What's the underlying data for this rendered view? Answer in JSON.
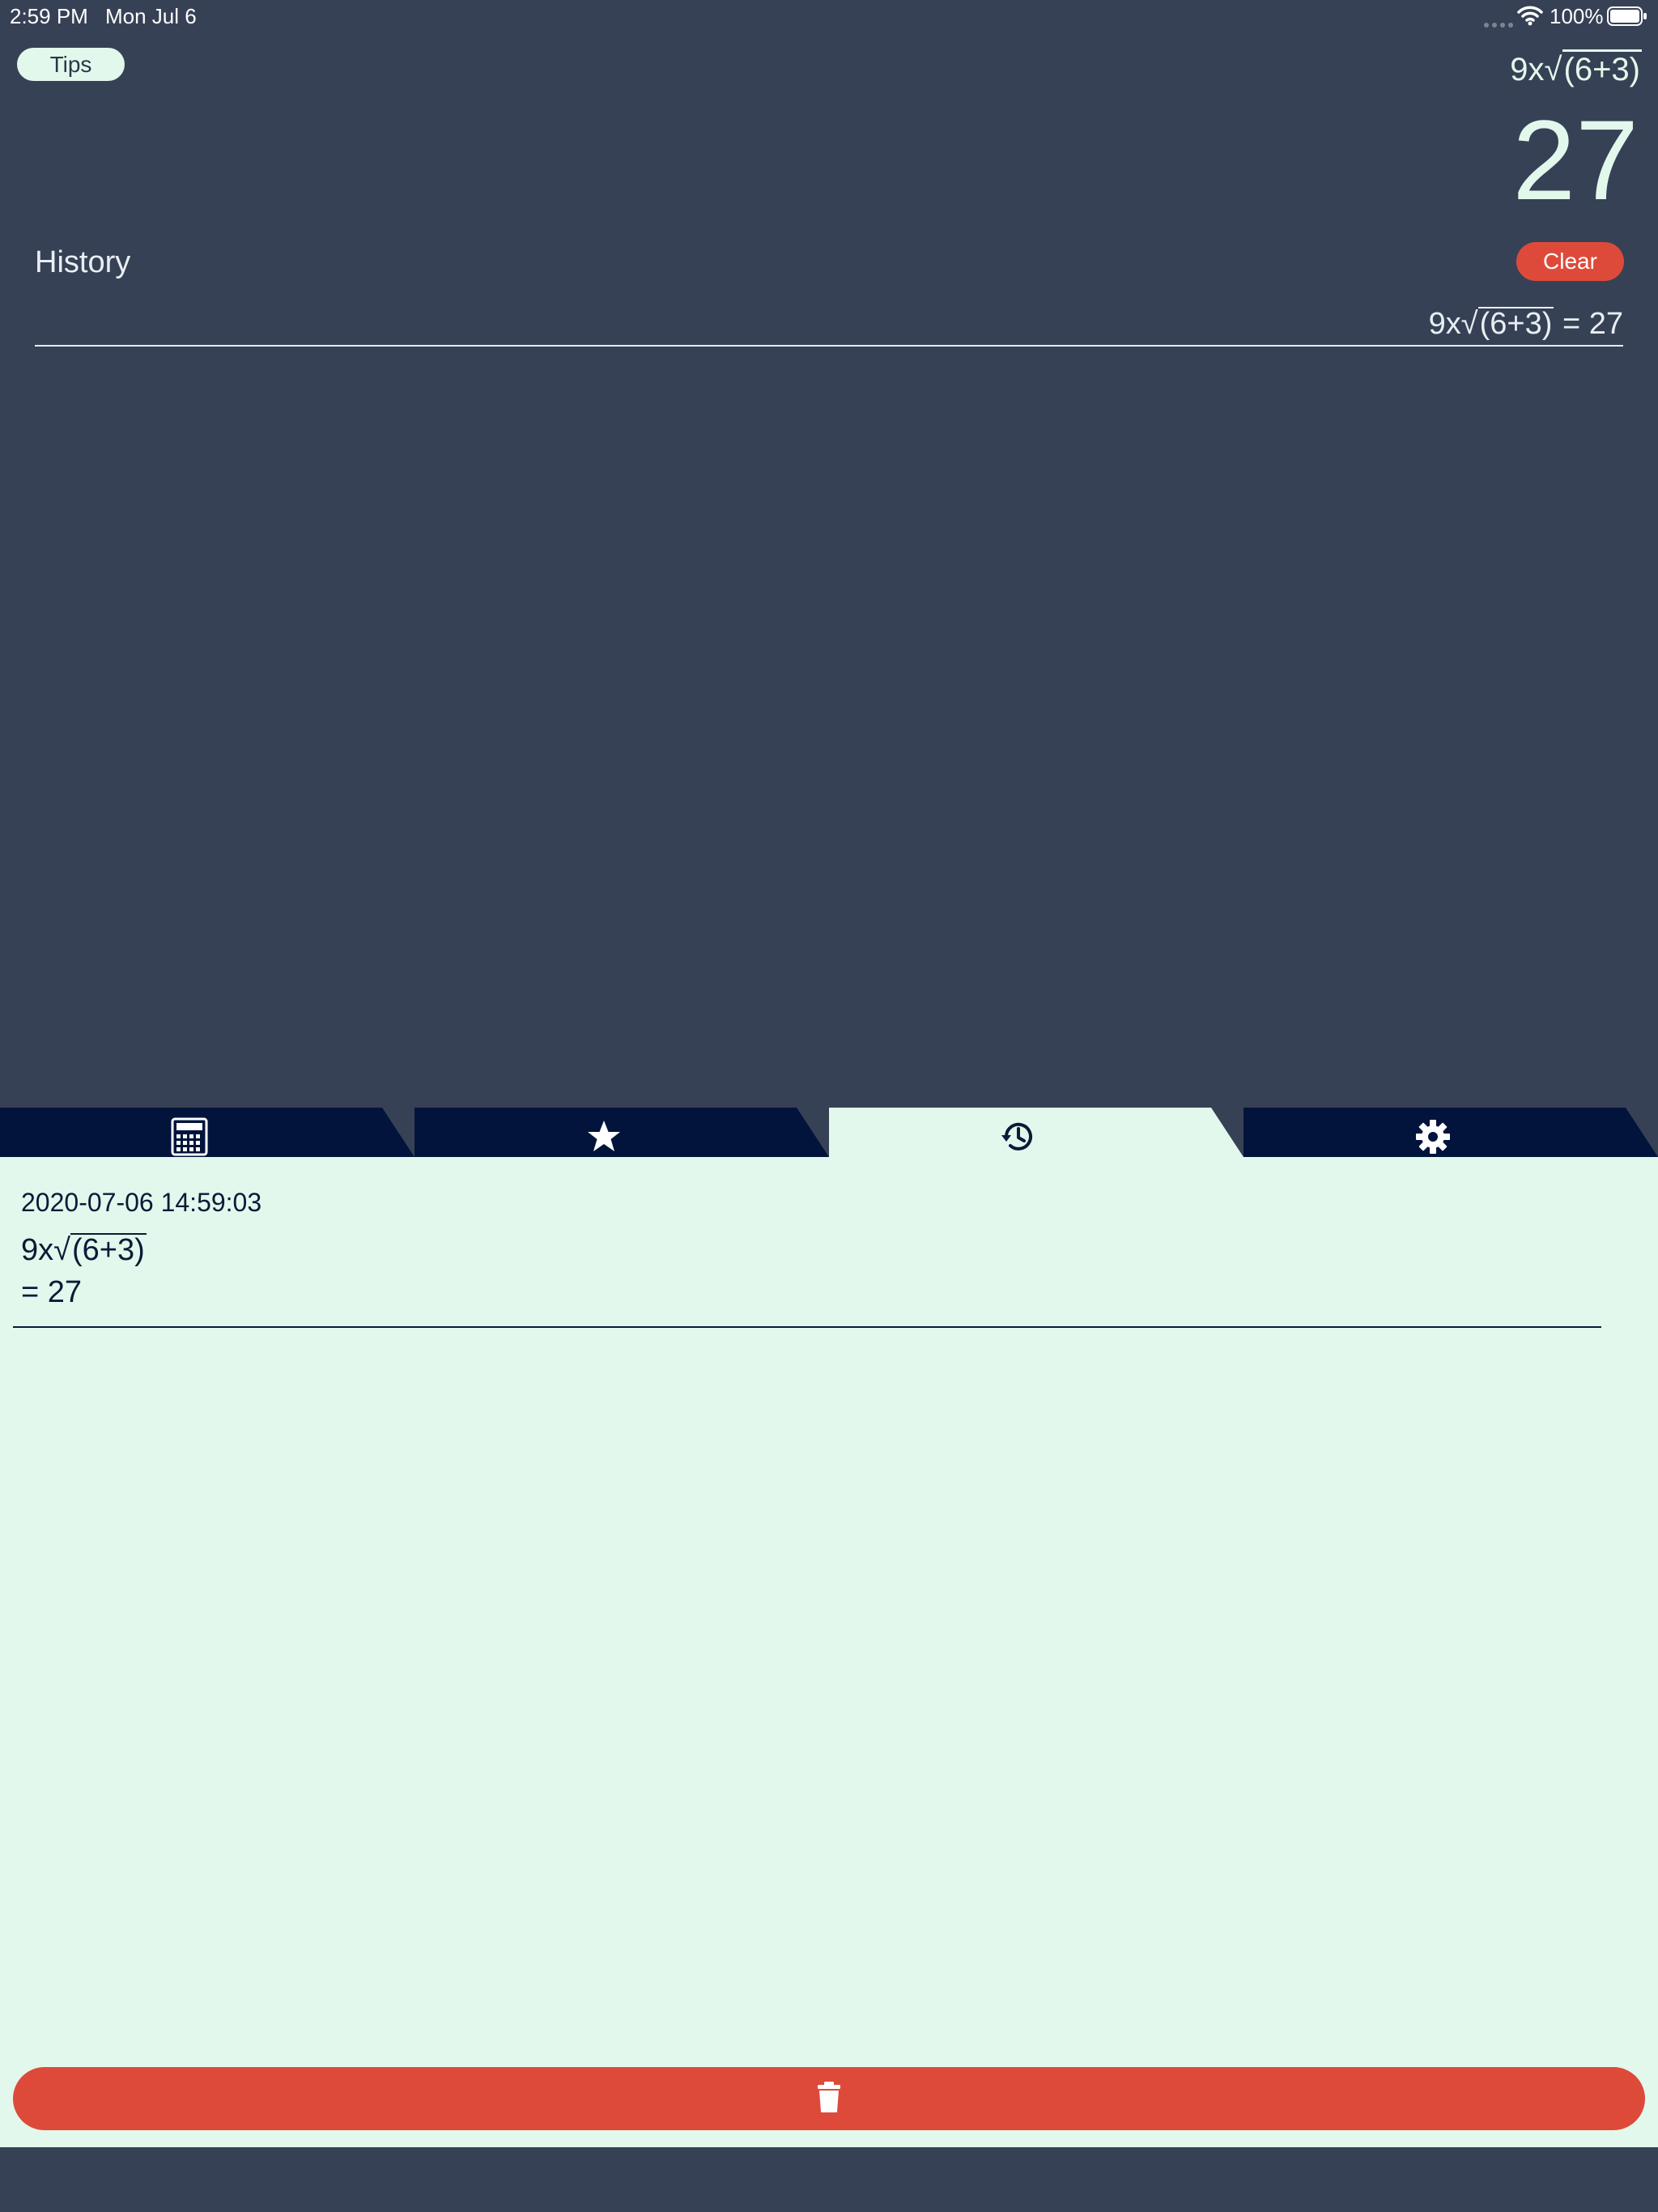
{
  "status_bar": {
    "time": "2:59 PM",
    "date": "Mon Jul 6",
    "battery": "100%"
  },
  "header": {
    "tips_label": "Tips",
    "expr_prefix": "9x",
    "expr_radicand": "(6+3)",
    "result": "27"
  },
  "history": {
    "title": "History",
    "clear_label": "Clear",
    "line_prefix": "9x",
    "line_radicand": "(6+3)",
    "line_suffix": " = 27"
  },
  "tabs": [
    {
      "name": "calculator",
      "icon": "calculator-icon",
      "active": false
    },
    {
      "name": "favorites",
      "icon": "star-icon",
      "active": false
    },
    {
      "name": "history",
      "icon": "history-icon",
      "active": true
    },
    {
      "name": "settings",
      "icon": "gear-icon",
      "active": false
    }
  ],
  "entries": [
    {
      "timestamp": "2020-07-06 14:59:03",
      "expr_prefix": "9x",
      "expr_radicand": "(6+3)",
      "result": "= 27"
    }
  ],
  "colors": {
    "background": "#374155",
    "panel": "#e2f8ec",
    "tab_dark": "#02143b",
    "accent_red": "#de4a3a"
  }
}
